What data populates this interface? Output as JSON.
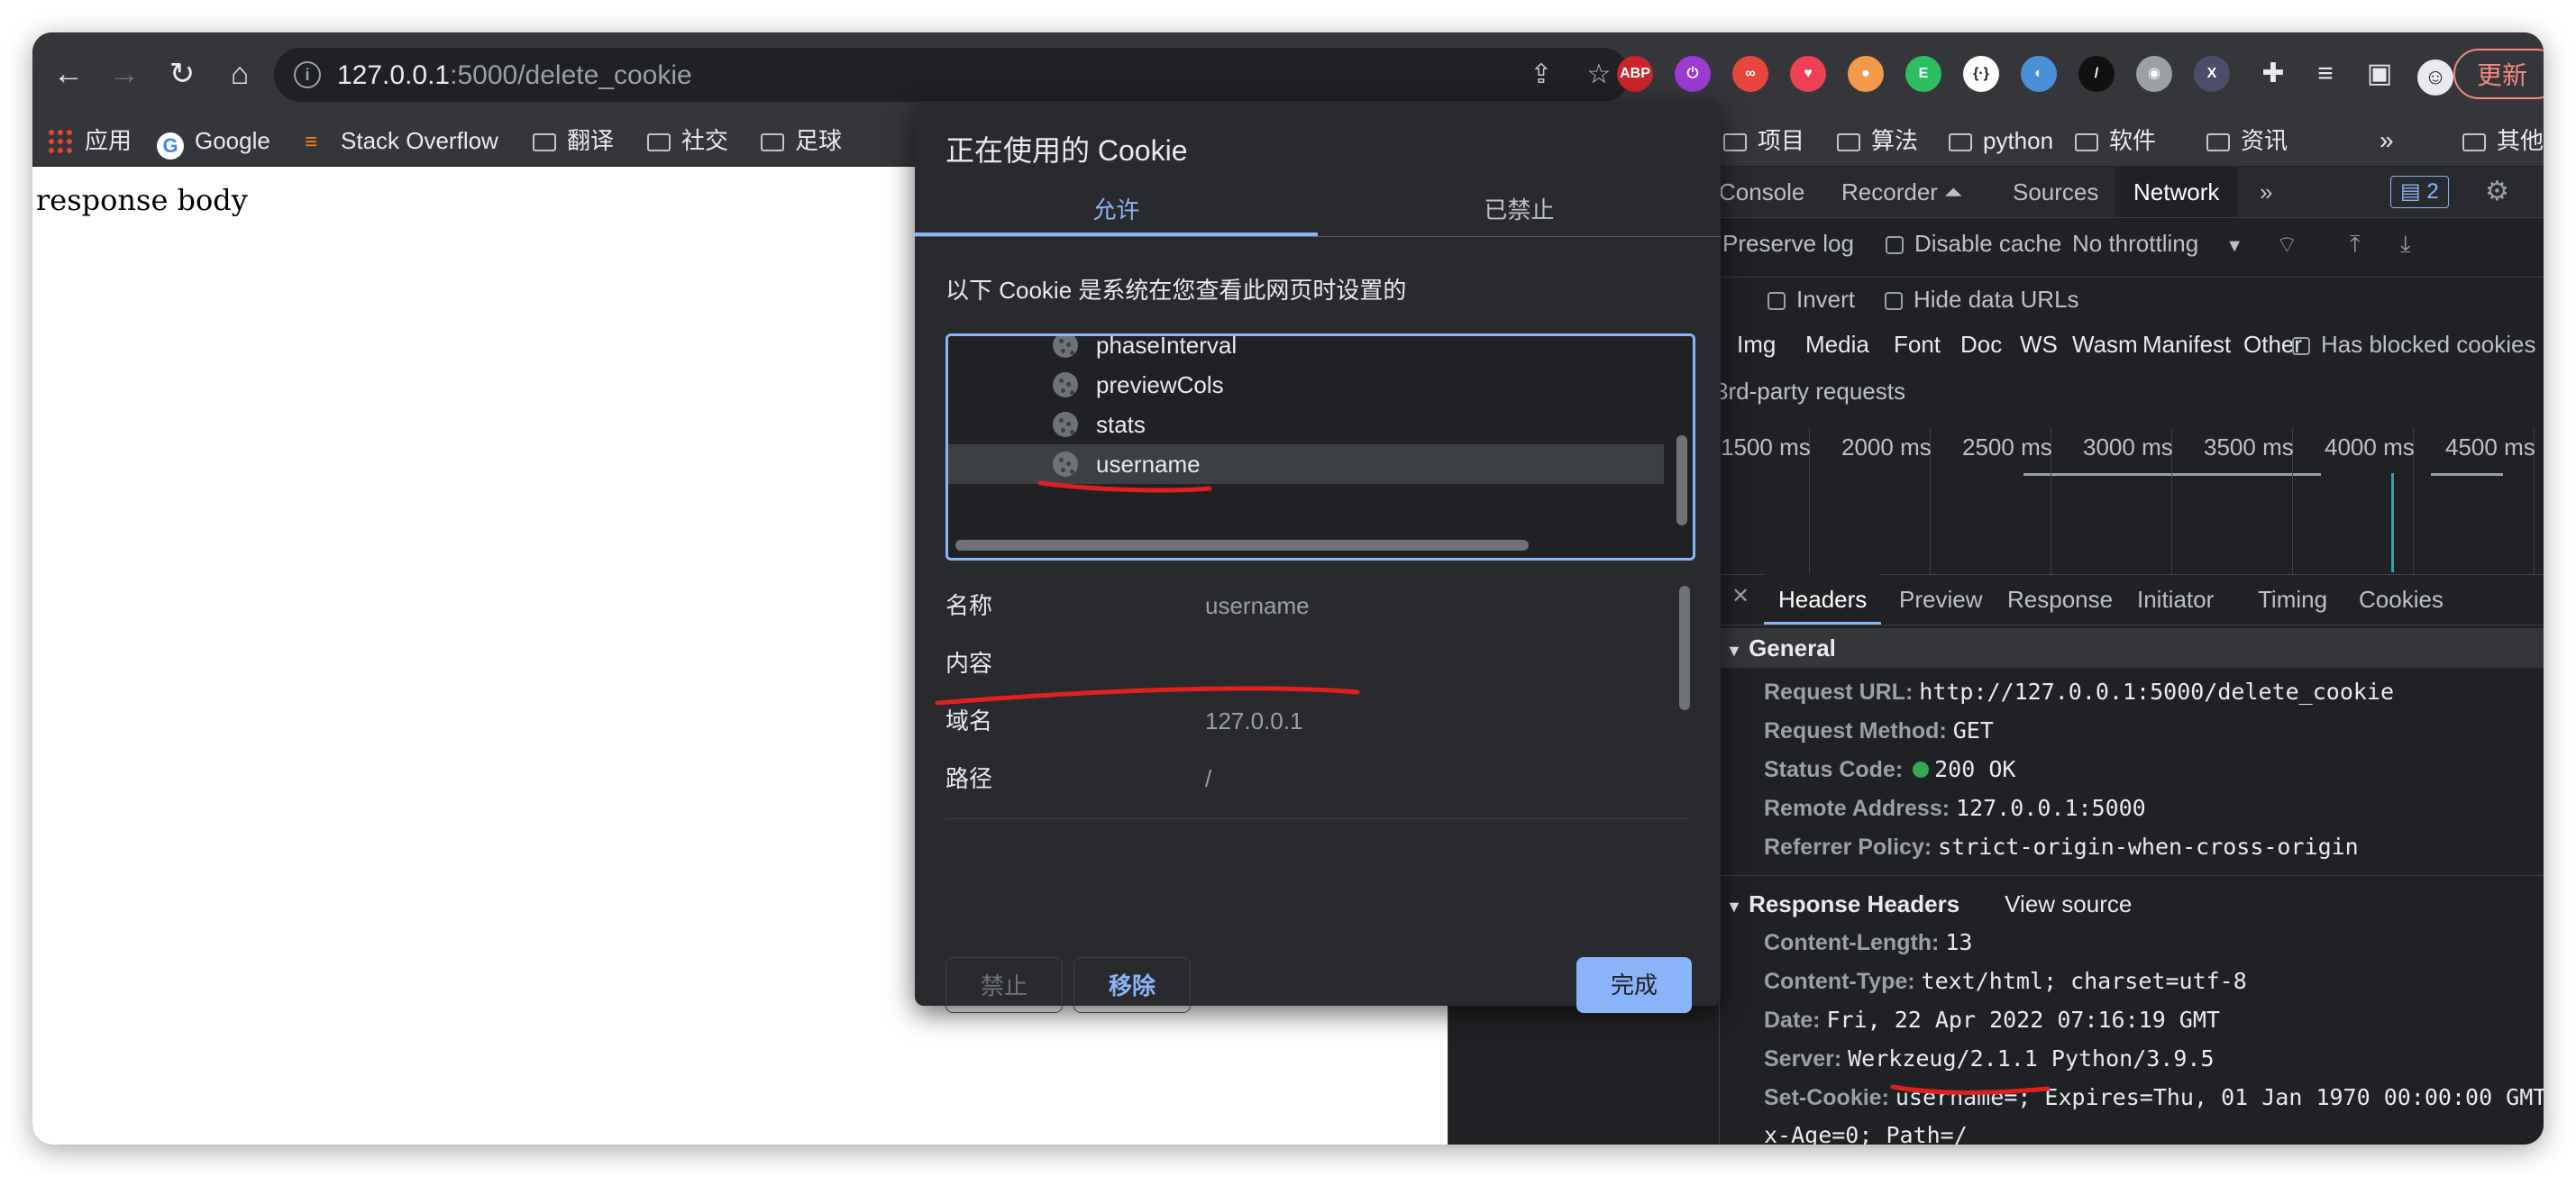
{
  "toolbar": {
    "url_host": "127.0.0.1",
    "url_rest": ":5000/delete_cookie",
    "update_label": "更新"
  },
  "extensions": [
    {
      "name": "abp-icon",
      "label": "ABP",
      "color": "#c9252b"
    },
    {
      "name": "power-icon",
      "label": "⏻",
      "color": "#9b3bd1"
    },
    {
      "name": "infinity-icon",
      "label": "∞",
      "color": "#e8453c"
    },
    {
      "name": "pocket-icon",
      "label": "♥",
      "color": "#ef4056"
    },
    {
      "name": "shapes-icon",
      "label": "●",
      "color": "#f2994a"
    },
    {
      "name": "evernote-icon",
      "label": "E",
      "color": "#2dbe60"
    },
    {
      "name": "code-icon",
      "label": "{·}",
      "color": "#ffffff"
    },
    {
      "name": "color-icon",
      "label": "◐",
      "color": "#4a90d9"
    },
    {
      "name": "feather-icon",
      "label": "/",
      "color": "#111111"
    },
    {
      "name": "camera-icon",
      "label": "◉",
      "color": "#9aa0a6"
    },
    {
      "name": "x-icon",
      "label": "X",
      "color": "#4a4e6a"
    }
  ],
  "bookmarks": [
    {
      "name": "bookmark-apps",
      "label": "应用",
      "type": "apps"
    },
    {
      "name": "bookmark-google",
      "label": "Google",
      "type": "google"
    },
    {
      "name": "bookmark-stackoverflow",
      "label": "Stack Overflow",
      "type": "so"
    },
    {
      "name": "bookmark-translate",
      "label": "翻译",
      "type": "folder"
    },
    {
      "name": "bookmark-social",
      "label": "社交",
      "type": "folder"
    },
    {
      "name": "bookmark-football",
      "label": "足球",
      "type": "folder"
    },
    {
      "name": "bookmark-projects",
      "label": "项目",
      "type": "folder"
    },
    {
      "name": "bookmark-algorithms",
      "label": "算法",
      "type": "folder"
    },
    {
      "name": "bookmark-python",
      "label": "python",
      "type": "folder"
    },
    {
      "name": "bookmark-software",
      "label": "软件",
      "type": "folder"
    },
    {
      "name": "bookmark-news",
      "label": "资讯",
      "type": "folder"
    },
    {
      "name": "bookmark-other",
      "label": "其他",
      "type": "folder"
    }
  ],
  "page": {
    "body_text": "response body"
  },
  "devtools": {
    "tabs": [
      "Console",
      "Recorder ⏶",
      "Sources",
      "Network"
    ],
    "issues_count": "2",
    "preserve_log": "Preserve log",
    "disable_cache": "Disable cache",
    "throttling": "No throttling",
    "invert": "Invert",
    "hide_data_urls": "Hide data URLs",
    "filters": [
      "Img",
      "Media",
      "Font",
      "Doc",
      "WS",
      "Wasm",
      "Manifest",
      "Other"
    ],
    "has_blocked_cookies": "Has blocked cookies",
    "third_party": "3rd-party requests",
    "timeline_ticks": [
      "1500 ms",
      "2000 ms",
      "2500 ms",
      "3000 ms",
      "3500 ms",
      "4000 ms",
      "4500 ms"
    ],
    "header_tabs": [
      "Headers",
      "Preview",
      "Response",
      "Initiator",
      "Timing",
      "Cookies"
    ],
    "general_title": "General",
    "general": [
      {
        "k": "Request URL:",
        "v": "http://127.0.0.1:5000/delete_cookie"
      },
      {
        "k": "Request Method:",
        "v": "GET"
      },
      {
        "k": "Status Code:",
        "v": "200 OK"
      },
      {
        "k": "Remote Address:",
        "v": "127.0.0.1:5000"
      },
      {
        "k": "Referrer Policy:",
        "v": "strict-origin-when-cross-origin"
      }
    ],
    "response_headers_title": "Response Headers",
    "view_source": "View source",
    "response_headers": [
      {
        "k": "Content-Length:",
        "v": "13"
      },
      {
        "k": "Content-Type:",
        "v": "text/html; charset=utf-8"
      },
      {
        "k": "Date:",
        "v": "Fri, 22 Apr 2022 07:16:19 GMT"
      },
      {
        "k": "Server:",
        "v": "Werkzeug/2.1.1 Python/3.9.5"
      },
      {
        "k": "Set-Cookie:",
        "v": "username=; Expires=Thu, 01 Jan 1970 00:00:00 GMT;"
      }
    ],
    "set_cookie_cont": "x-Age=0; Path=/"
  },
  "dialog": {
    "title": "正在使用的 Cookie",
    "tab_allowed": "允许",
    "tab_blocked": "已禁止",
    "description": "以下 Cookie 是系统在您查看此网页时设置的",
    "cookies": [
      "phaseInterval",
      "previewCols",
      "stats",
      "username"
    ],
    "details": [
      {
        "k": "名称",
        "v": "username"
      },
      {
        "k": "内容",
        "v": ""
      },
      {
        "k": "域名",
        "v": "127.0.0.1"
      },
      {
        "k": "路径",
        "v": "/"
      }
    ],
    "btn_block": "禁止",
    "btn_remove": "移除",
    "btn_done": "完成"
  }
}
